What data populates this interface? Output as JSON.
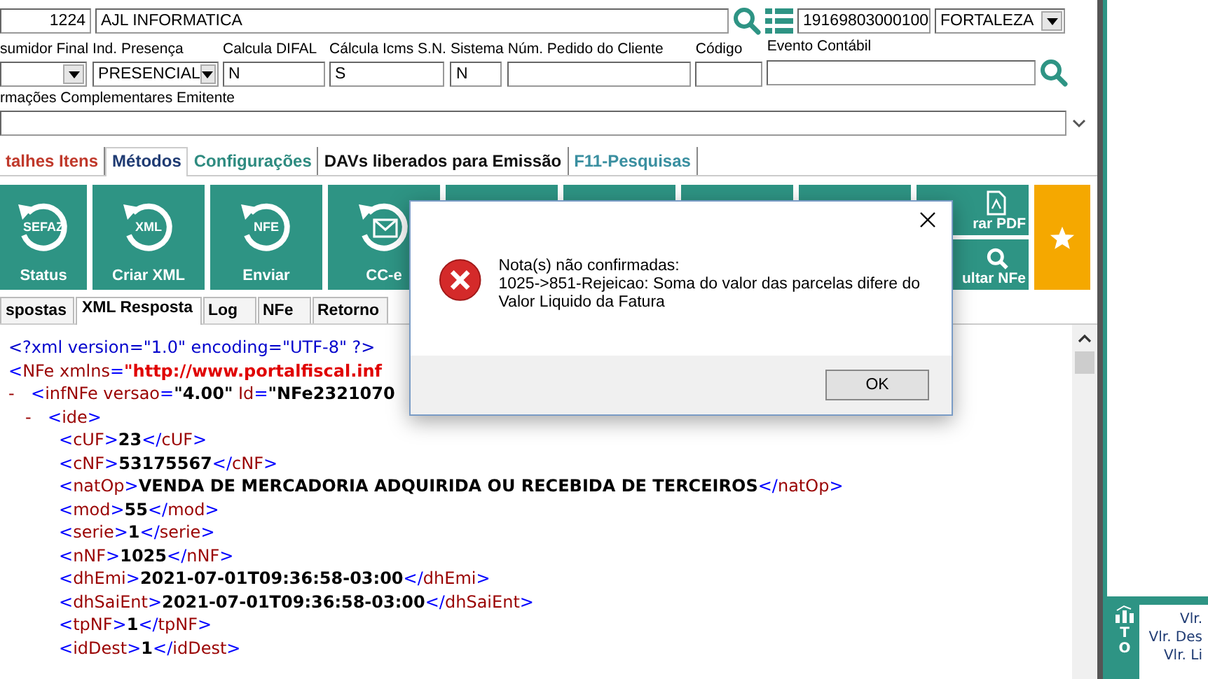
{
  "header": {
    "code": "1224",
    "client": "AJL INFORMATICA",
    "cnpj": "19169803000100",
    "municipio": "FORTALEZA"
  },
  "fields": [
    {
      "label": "sumidor Final",
      "kind": "select"
    },
    {
      "label": "Ind. Presença",
      "kind": "select",
      "value": "PRESENCIAL"
    },
    {
      "label": "Calcula DIFAL",
      "kind": "text",
      "value": "N"
    },
    {
      "label": "Cálcula Icms S.N.",
      "kind": "text",
      "value": "S"
    },
    {
      "label": "Sistema",
      "kind": "text",
      "value": "N"
    },
    {
      "label": "Núm. Pedido do Cliente",
      "kind": "text"
    },
    {
      "label": "Código",
      "kind": "text"
    },
    {
      "label": "Evento Contábil",
      "kind": "search"
    }
  ],
  "notes": {
    "label": "rmações Complementares Emitente"
  },
  "tabs": [
    {
      "label": "talhes Itens",
      "selected": false,
      "color": "#c0392b"
    },
    {
      "label": "Métodos",
      "selected": true,
      "color": "#1f3b73"
    },
    {
      "label": "Configurações",
      "selected": false,
      "color": "#2e8b80"
    },
    {
      "label": "DAVs liberados para Emissão",
      "selected": false,
      "color": "#111111"
    },
    {
      "label": "F11-Pesquisas",
      "selected": false,
      "color": "#3a8fa0"
    }
  ],
  "tiles": [
    {
      "kind": "refresh",
      "label": "Status",
      "icon_text": "SEFAZ"
    },
    {
      "kind": "refresh",
      "label": "Criar XML",
      "icon_text": "XML"
    },
    {
      "kind": "refresh",
      "label": "Enviar",
      "icon_text": "NFE"
    },
    {
      "kind": "mail",
      "label": "CC-e"
    },
    {
      "kind": "blank"
    },
    {
      "kind": "blank"
    },
    {
      "kind": "blank"
    },
    {
      "kind": "blank"
    },
    {
      "kind": "split",
      "items": [
        {
          "kind": "pdf",
          "label": "rar PDF"
        },
        {
          "kind": "search",
          "label": "ultar NFe"
        }
      ]
    },
    {
      "kind": "favorite"
    }
  ],
  "subtabs": [
    {
      "label": "spostas",
      "selected": false
    },
    {
      "label": "XML Resposta",
      "selected": true
    },
    {
      "label": "Log",
      "selected": false
    },
    {
      "label": "NFe",
      "selected": false
    },
    {
      "label": "Retorno",
      "selected": false
    }
  ],
  "xml": [
    {
      "segments": [
        {
          "kind": "decl",
          "text": "<?xml version=\"1.0\" encoding=\"UTF-8\" ?>"
        }
      ]
    },
    {
      "segments": [
        {
          "kind": "tag",
          "text": "<NFe xmlns="
        },
        {
          "kind": "ns",
          "text": "\"http://www.portalfiscal.inf"
        }
      ],
      "children": [
        {
          "toggle": "-",
          "segments": [
            {
              "kind": "tag",
              "text": "<infNFe versao="
            },
            {
              "kind": "value",
              "text": "\"4.00\""
            },
            {
              "kind": "tag",
              "text": " Id="
            },
            {
              "kind": "value",
              "text": "\"NFe2321070"
            }
          ],
          "children": [
            {
              "toggle": "-",
              "segments": [
                {
                  "kind": "tag",
                  "text": "<ide>"
                }
              ],
              "children": [
                {
                  "segments": [
                    {
                      "kind": "tag",
                      "text": "<cUF>"
                    },
                    {
                      "kind": "value",
                      "text": "23"
                    },
                    {
                      "kind": "tag",
                      "text": "</cUF>"
                    }
                  ]
                },
                {
                  "segments": [
                    {
                      "kind": "tag",
                      "text": "<cNF>"
                    },
                    {
                      "kind": "value",
                      "text": "53175567"
                    },
                    {
                      "kind": "tag",
                      "text": "</cNF>"
                    }
                  ]
                },
                {
                  "segments": [
                    {
                      "kind": "tag",
                      "text": "<natOp>"
                    },
                    {
                      "kind": "value",
                      "text": "VENDA DE MERCADORIA ADQUIRIDA OU RECEBIDA DE TERCEIROS"
                    },
                    {
                      "kind": "tag",
                      "text": "</natOp>"
                    }
                  ]
                },
                {
                  "segments": [
                    {
                      "kind": "tag",
                      "text": "<mod>"
                    },
                    {
                      "kind": "value",
                      "text": "55"
                    },
                    {
                      "kind": "tag",
                      "text": "</mod>"
                    }
                  ]
                },
                {
                  "segments": [
                    {
                      "kind": "tag",
                      "text": "<serie>"
                    },
                    {
                      "kind": "value",
                      "text": "1"
                    },
                    {
                      "kind": "tag",
                      "text": "</serie>"
                    }
                  ]
                },
                {
                  "segments": [
                    {
                      "kind": "tag",
                      "text": "<nNF>"
                    },
                    {
                      "kind": "value",
                      "text": "1025"
                    },
                    {
                      "kind": "tag",
                      "text": "</nNF>"
                    }
                  ]
                },
                {
                  "segments": [
                    {
                      "kind": "tag",
                      "text": "<dhEmi>"
                    },
                    {
                      "kind": "value",
                      "text": "2021-07-01T09:36:58-03:00"
                    },
                    {
                      "kind": "tag",
                      "text": "</dhEmi>"
                    }
                  ]
                },
                {
                  "segments": [
                    {
                      "kind": "tag",
                      "text": "<dhSaiEnt>"
                    },
                    {
                      "kind": "value",
                      "text": "2021-07-01T09:36:58-03:00"
                    },
                    {
                      "kind": "tag",
                      "text": "</dhSaiEnt>"
                    }
                  ]
                },
                {
                  "segments": [
                    {
                      "kind": "tag",
                      "text": "<tpNF>"
                    },
                    {
                      "kind": "value",
                      "text": "1"
                    },
                    {
                      "kind": "tag",
                      "text": "</tpNF>"
                    }
                  ]
                },
                {
                  "segments": [
                    {
                      "kind": "tag",
                      "text": "<idDest>"
                    },
                    {
                      "kind": "value",
                      "text": "1"
                    },
                    {
                      "kind": "tag",
                      "text": "</idDest>"
                    }
                  ]
                }
              ]
            }
          ]
        }
      ]
    }
  ],
  "dialog": {
    "lines": [
      "Nota(s) não confirmadas:",
      "1025->851-Rejeicao: Soma do valor das parcelas difere do Valor Liquido da Fatura"
    ],
    "button": "OK"
  },
  "totals": {
    "side_label": "TO",
    "rows": [
      "Vlr.",
      "Vlr. Des",
      "Vlr. Li"
    ]
  }
}
